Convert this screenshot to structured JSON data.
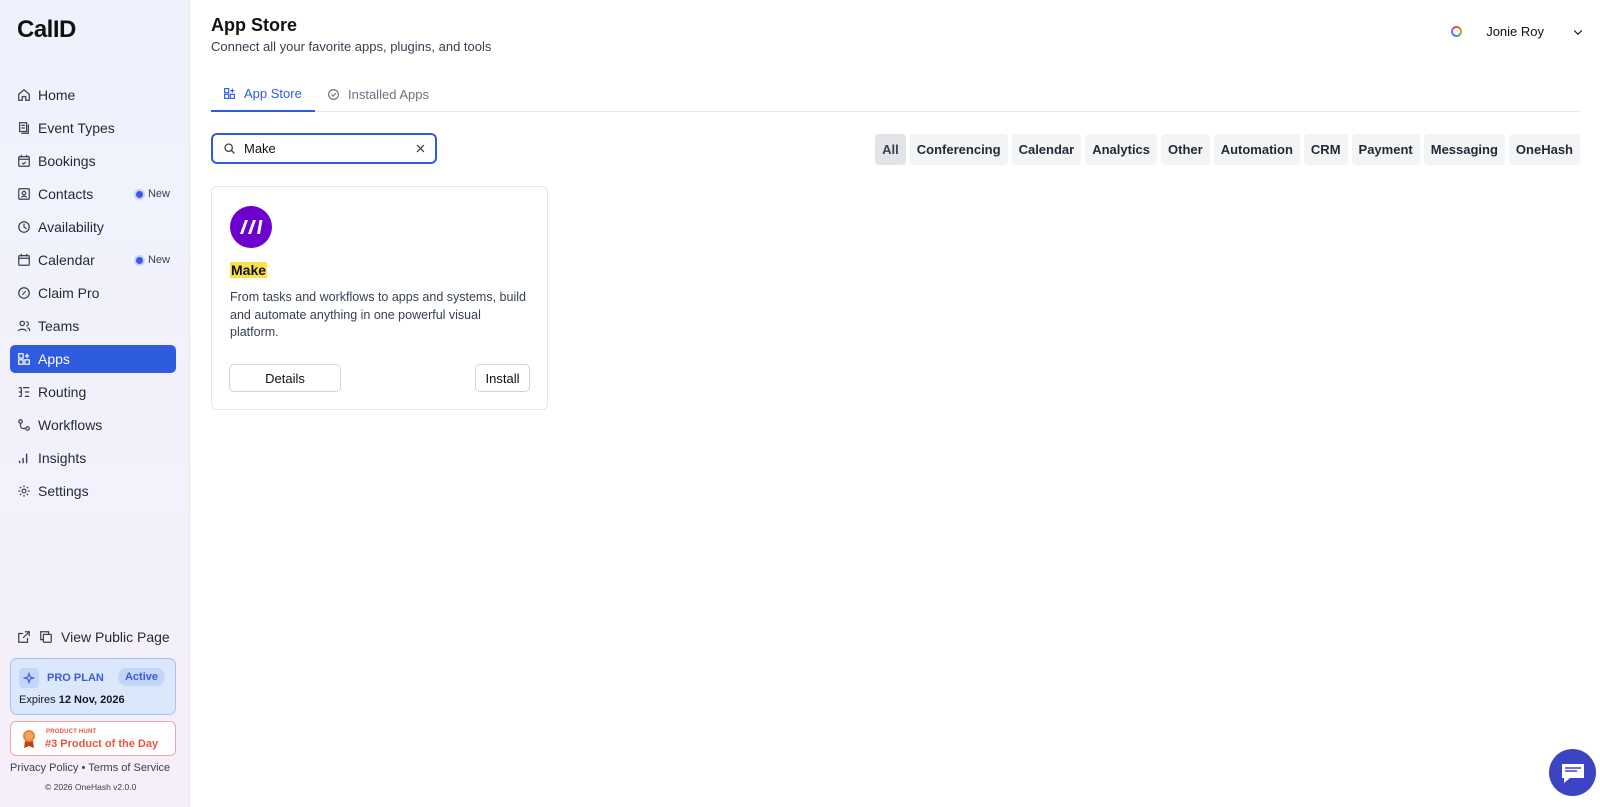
{
  "brand": {
    "logo": "CalID"
  },
  "sidebar": {
    "items": [
      {
        "label": "Home",
        "icon": "home-icon"
      },
      {
        "label": "Event Types",
        "icon": "event-types-icon"
      },
      {
        "label": "Bookings",
        "icon": "calendar-check-icon"
      },
      {
        "label": "Contacts",
        "icon": "contacts-icon",
        "badge": "New"
      },
      {
        "label": "Availability",
        "icon": "clock-icon"
      },
      {
        "label": "Calendar",
        "icon": "calendar-icon",
        "badge": "New"
      },
      {
        "label": "Claim Pro",
        "icon": "badge-icon"
      },
      {
        "label": "Teams",
        "icon": "users-icon"
      },
      {
        "label": "Apps",
        "icon": "grid-plus-icon",
        "active": true
      },
      {
        "label": "Routing",
        "icon": "routing-icon"
      },
      {
        "label": "Workflows",
        "icon": "workflow-icon"
      },
      {
        "label": "Insights",
        "icon": "bar-chart-icon"
      },
      {
        "label": "Settings",
        "icon": "gear-icon"
      }
    ],
    "public_page": "View Public Page",
    "plan": {
      "name": "PRO PLAN",
      "status": "Active",
      "expires_label": "Expires",
      "expires_date": "12 Nov, 2026"
    },
    "product_hunt": {
      "small": "PRODUCT HUNT",
      "big": "#3 Product of the Day"
    },
    "footer": {
      "privacy": "Privacy Policy",
      "separator": "•",
      "terms": "Terms of Service",
      "copyright": "© 2026 OneHash v2.0.0"
    }
  },
  "header": {
    "title": "App Store",
    "subtitle": "Connect all your favorite apps, plugins, and tools",
    "user_name": "Jonie Roy"
  },
  "tabs": [
    {
      "label": "App Store",
      "active": true
    },
    {
      "label": "Installed Apps",
      "active": false
    }
  ],
  "search": {
    "value": "Make"
  },
  "filters": [
    "All",
    "Conferencing",
    "Calendar",
    "Analytics",
    "Other",
    "Automation",
    "CRM",
    "Payment",
    "Messaging",
    "OneHash"
  ],
  "active_filter": "All",
  "apps": [
    {
      "name": "Make",
      "description": "From tasks and workflows to apps and systems, build and automate anything in one powerful visual platform.",
      "details_label": "Details",
      "install_label": "Install",
      "logo_color": "#6d00cc"
    }
  ],
  "colors": {
    "accent": "#2f5bdf",
    "chat": "#3b45c4",
    "highlight": "#fde047"
  }
}
